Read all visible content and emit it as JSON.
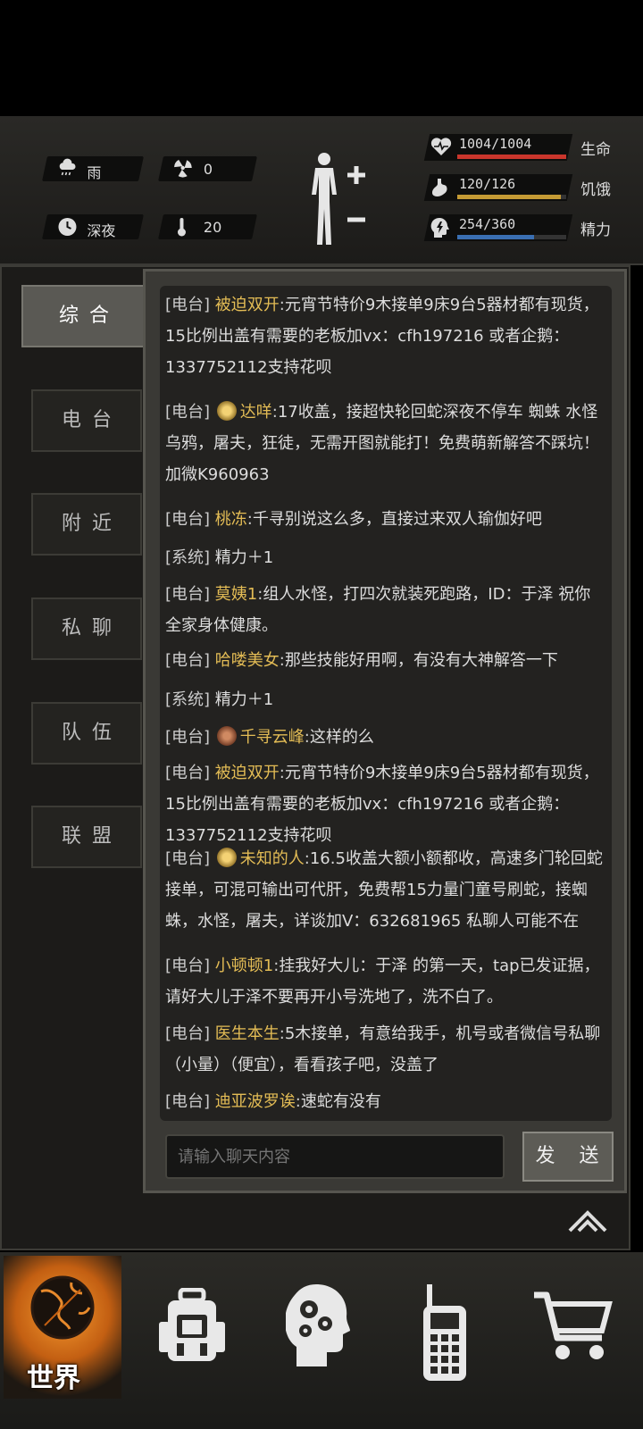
{
  "status": {
    "weather": {
      "icon": "rain-cloud-icon",
      "label": "雨"
    },
    "radiation": {
      "icon": "radiation-icon",
      "value": "0"
    },
    "time_of_day": {
      "icon": "clock-icon",
      "label": "深夜"
    },
    "temperature": {
      "icon": "thermometer-icon",
      "value": "20"
    },
    "health": {
      "value": "1004/1004",
      "label": "生命",
      "fraction": 1.0,
      "color": "#c9362c"
    },
    "hunger": {
      "value": "120/126",
      "label": "饥饿",
      "fraction": 0.952,
      "color": "#c49a34"
    },
    "energy": {
      "value": "254/360",
      "label": "精力",
      "fraction": 0.706,
      "color": "#3a6fb2"
    }
  },
  "channels": {
    "active": "综合",
    "tabs": [
      "综合",
      "电台",
      "附近",
      "私聊",
      "队伍",
      "联盟"
    ]
  },
  "messages": [
    {
      "channel": "[电台]",
      "name": "被迫双开",
      "text": "元宵节特价9木接单9床9台5器材都有现货，15比例出盖有需要的老板加vx：cfh197216 或者企鹅：1337752112支持花呗"
    },
    {
      "channel": "[电台]",
      "badge": "gold",
      "name": "达咩",
      "text": "17收盖，接超快轮回蛇深夜不停车 蜘蛛 水怪乌鸦，屠夫，狂徒，无需开图就能打！免费萌新解答不踩坑！加微K960963"
    },
    {
      "channel": "[电台]",
      "name": "桃冻",
      "text": "千寻别说这么多，直接过来双人瑜伽好吧"
    },
    {
      "channel": "[系统]",
      "name": "",
      "text": "精力＋1"
    },
    {
      "channel": "[电台]",
      "name": "莫姨1",
      "text": "组人水怪，打四次就装死跑路，ID：于泽 祝你全家身体健康。"
    },
    {
      "channel": "[电台]",
      "name": "哈喽美女",
      "text": "那些技能好用啊，有没有大神解答一下"
    },
    {
      "channel": "[系统]",
      "name": "",
      "text": "精力＋1"
    },
    {
      "channel": "[电台]",
      "badge": "bronze",
      "name": "千寻云峰",
      "text": "这样的么"
    },
    {
      "channel": "[电台]",
      "name": "被迫双开",
      "text": "元宵节特价9木接单9床9台5器材都有现货，15比例出盖有需要的老板加vx：cfh197216 或者企鹅：1337752112支持花呗"
    },
    {
      "channel": "[电台]",
      "badge": "gold",
      "name": "未知的人",
      "text": "16.5收盖大额小额都收，高速多门轮回蛇接单，可混可输出可代肝，免费帮15力量门童号刷蛇，接蜘蛛，水怪，屠夫，详谈加V：632681965 私聊人可能不在"
    },
    {
      "channel": "[电台]",
      "name": "小顿顿1",
      "text": "挂我好大儿：于泽 的第一天，tap已发证据，请好大儿于泽不要再开小号洗地了，洗不白了。"
    },
    {
      "channel": "[电台]",
      "name": "医生本生",
      "text": "5木接单，有意给我手，机号或者微信号私聊（小量）（便宜），看看孩子吧，没盖了"
    },
    {
      "channel": "[电台]",
      "name": "迪亚波罗诶",
      "text": "速蛇有没有"
    }
  ],
  "chat_input": {
    "placeholder": "请输入聊天内容"
  },
  "send_button": "发 送",
  "bottom_nav": {
    "world_label": "世界",
    "items": [
      "globe-icon",
      "backpack-icon",
      "brain-gears-icon",
      "walkie-talkie-icon",
      "shopping-cart-icon"
    ]
  }
}
